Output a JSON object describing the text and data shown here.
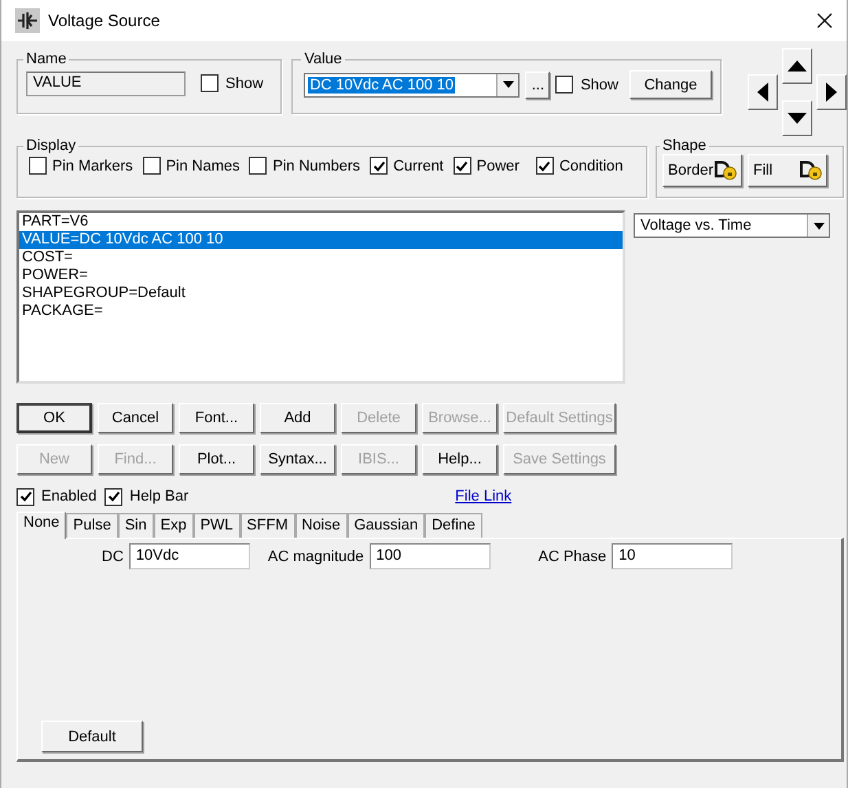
{
  "window": {
    "title": "Voltage Source"
  },
  "name": {
    "label": "Name",
    "value": "VALUE",
    "show": {
      "label": "Show",
      "checked": false
    }
  },
  "value": {
    "label": "Value",
    "value": "DC 10Vdc AC 100 10",
    "browse": "...",
    "show": {
      "label": "Show",
      "checked": false
    },
    "change": "Change"
  },
  "display": {
    "label": "Display",
    "options": [
      {
        "label": "Pin Markers",
        "checked": false
      },
      {
        "label": "Pin Names",
        "checked": false
      },
      {
        "label": "Pin Numbers",
        "checked": false
      },
      {
        "label": "Current",
        "checked": true
      },
      {
        "label": "Power",
        "checked": true
      },
      {
        "label": "Condition",
        "checked": true
      }
    ]
  },
  "shape": {
    "label": "Shape",
    "buttons": [
      "Border",
      "Fill"
    ]
  },
  "attributes": [
    {
      "text": "PART=V6",
      "selected": false
    },
    {
      "text": "VALUE=DC 10Vdc AC 100 10",
      "selected": true
    },
    {
      "text": "COST=",
      "selected": false
    },
    {
      "text": "POWER=",
      "selected": false
    },
    {
      "text": "SHAPEGROUP=Default",
      "selected": false
    },
    {
      "text": "PACKAGE=",
      "selected": false
    }
  ],
  "plot_select": {
    "value": "Voltage vs. Time"
  },
  "button_rows": [
    [
      {
        "label": "OK",
        "disabled": false,
        "default": true
      },
      {
        "label": "Cancel",
        "disabled": false,
        "default": false
      },
      {
        "label": "Font...",
        "disabled": false,
        "default": false
      },
      {
        "label": "Add",
        "disabled": false,
        "default": false
      },
      {
        "label": "Delete",
        "disabled": true,
        "default": false
      },
      {
        "label": "Browse...",
        "disabled": true,
        "default": false
      },
      {
        "label": "Default Settings",
        "disabled": true,
        "default": false
      }
    ],
    [
      {
        "label": "New",
        "disabled": true,
        "default": false
      },
      {
        "label": "Find...",
        "disabled": true,
        "default": false
      },
      {
        "label": "Plot...",
        "disabled": false,
        "default": false
      },
      {
        "label": "Syntax...",
        "disabled": false,
        "default": false
      },
      {
        "label": "IBIS...",
        "disabled": true,
        "default": false
      },
      {
        "label": "Help...",
        "disabled": false,
        "default": false
      },
      {
        "label": "Save Settings",
        "disabled": true,
        "default": false
      }
    ]
  ],
  "options": [
    {
      "label": "Enabled",
      "checked": true
    },
    {
      "label": "Help Bar",
      "checked": true
    }
  ],
  "file_link": "File Link",
  "tabs": [
    {
      "label": "None",
      "selected": true
    },
    {
      "label": "Pulse",
      "selected": false
    },
    {
      "label": "Sin",
      "selected": false
    },
    {
      "label": "Exp",
      "selected": false
    },
    {
      "label": "PWL",
      "selected": false
    },
    {
      "label": "SFFM",
      "selected": false
    },
    {
      "label": "Noise",
      "selected": false
    },
    {
      "label": "Gaussian",
      "selected": false
    },
    {
      "label": "Define",
      "selected": false
    }
  ],
  "fields": [
    {
      "label": "DC",
      "value": "10Vdc"
    },
    {
      "label": "AC magnitude",
      "value": "100"
    },
    {
      "label": "AC Phase",
      "value": "10"
    }
  ],
  "default_button": "Default"
}
